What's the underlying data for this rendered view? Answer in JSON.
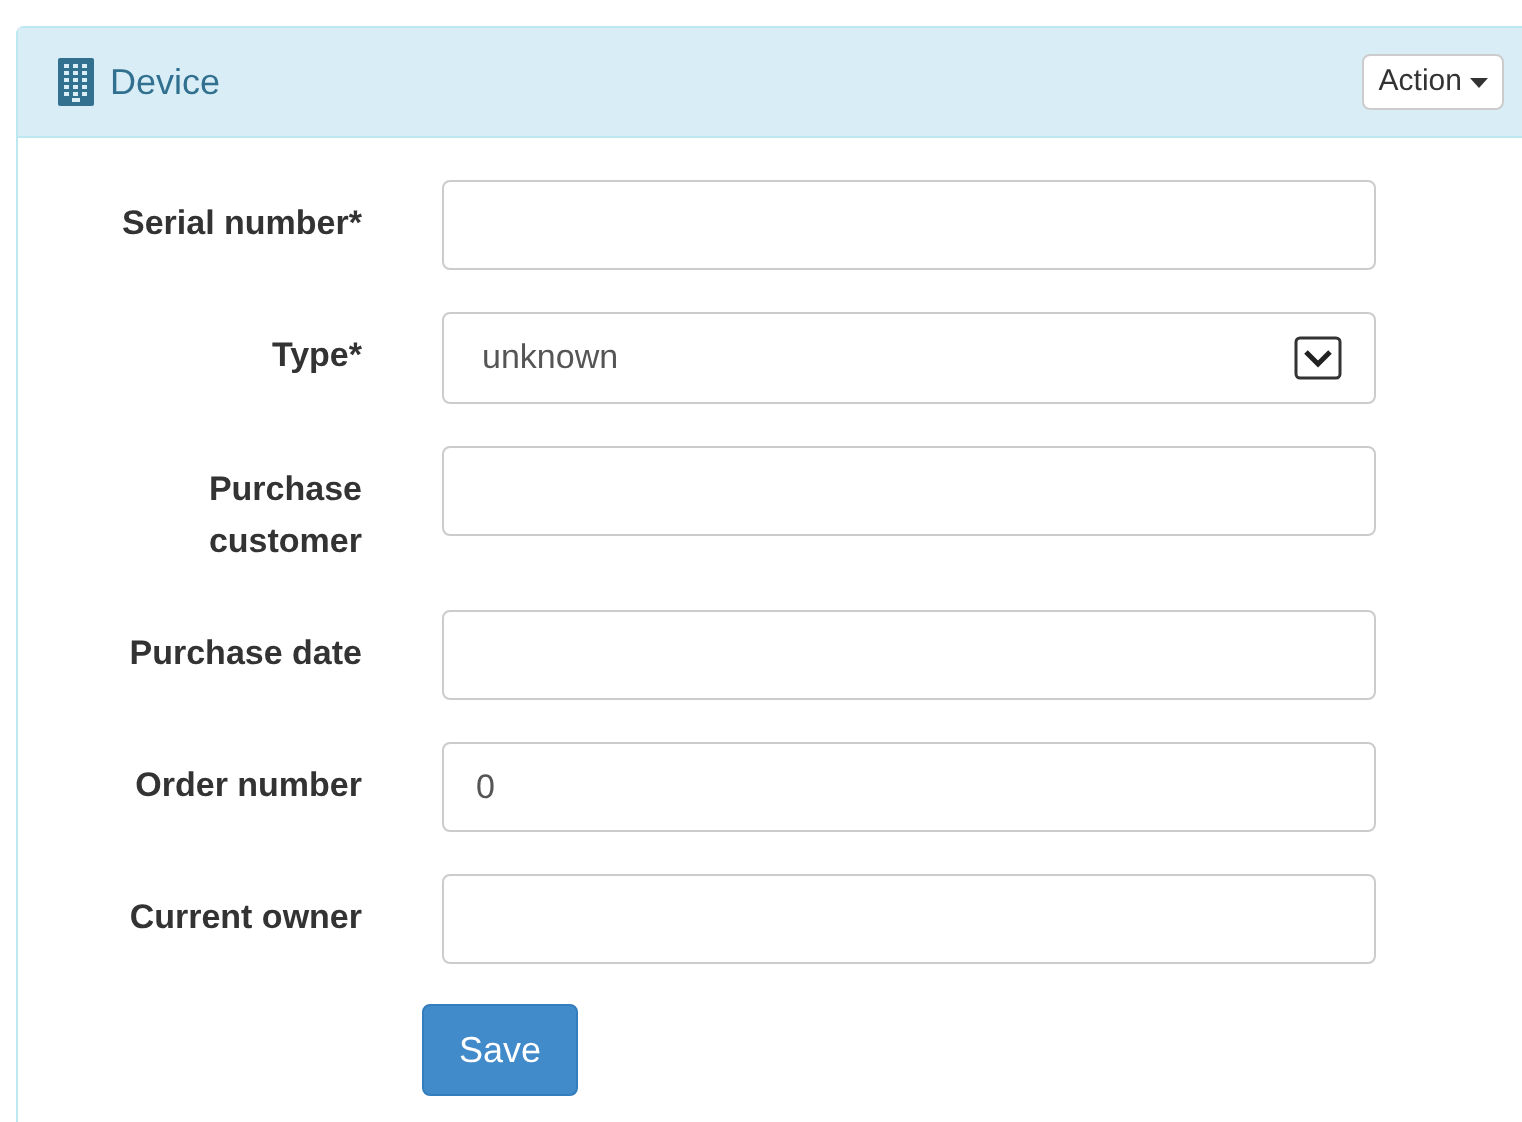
{
  "panel": {
    "title": "Device",
    "action_button": "Action"
  },
  "fields": [
    {
      "kind": "text",
      "label": "Serial number*"
    },
    {
      "kind": "select",
      "label": "Type*",
      "value": "unknown"
    },
    {
      "kind": "text",
      "label": "Purchase customer"
    },
    {
      "kind": "text",
      "label": "Purchase date"
    },
    {
      "kind": "text",
      "label": "Order number",
      "value": "0"
    },
    {
      "kind": "text",
      "label": "Current owner"
    }
  ],
  "save_button": "Save"
}
